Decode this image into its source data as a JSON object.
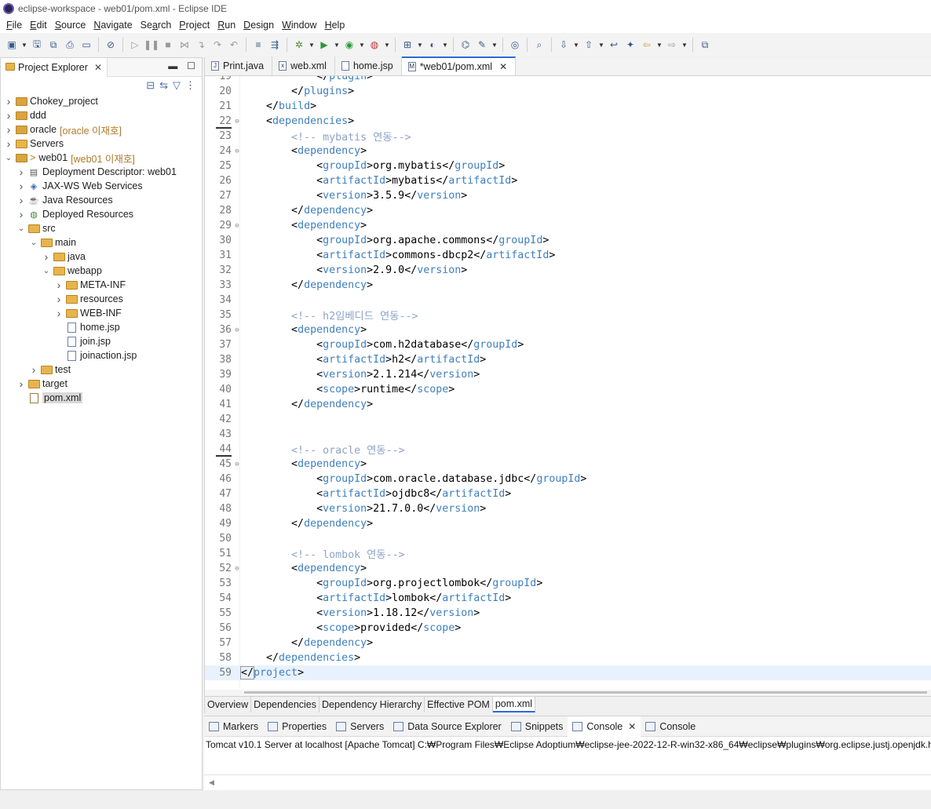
{
  "window": {
    "title": "eclipse-workspace - web01/pom.xml - Eclipse IDE"
  },
  "menu": [
    {
      "label": "File",
      "mn": "F",
      "rest": "ile"
    },
    {
      "label": "Edit",
      "mn": "E",
      "rest": "dit"
    },
    {
      "label": "Source",
      "mn": "S",
      "rest": "ource"
    },
    {
      "label": "Navigate",
      "mn": "N",
      "rest": "avigate"
    },
    {
      "label": "Search",
      "mn": "a",
      "pre": "Se",
      "rest": "rch"
    },
    {
      "label": "Project",
      "mn": "P",
      "rest": "roject"
    },
    {
      "label": "Run",
      "mn": "R",
      "rest": "un"
    },
    {
      "label": "Design",
      "mn": "D",
      "rest": "esign"
    },
    {
      "label": "Window",
      "mn": "W",
      "rest": "indow"
    },
    {
      "label": "Help",
      "mn": "H",
      "rest": "elp"
    }
  ],
  "explorer": {
    "tab_label": "Project Explorer",
    "items": [
      {
        "label": "Chokey_project",
        "decoration": ""
      },
      {
        "label": "ddd",
        "decoration": ""
      },
      {
        "label": "oracle",
        "decoration": "[oracle 이재호]"
      },
      {
        "label": "Servers",
        "decoration": ""
      },
      {
        "label": "web01",
        "prefix": ">",
        "decoration": "[web01 이재호]"
      },
      {
        "label": "Deployment Descriptor: web01",
        "decoration": ""
      },
      {
        "label": "JAX-WS Web Services",
        "decoration": ""
      },
      {
        "label": "Java Resources",
        "decoration": ""
      },
      {
        "label": "Deployed Resources",
        "decoration": ""
      },
      {
        "label": "src",
        "decoration": ""
      },
      {
        "label": "main",
        "decoration": ""
      },
      {
        "label": "java",
        "decoration": ""
      },
      {
        "label": "webapp",
        "decoration": ""
      },
      {
        "label": "META-INF",
        "decoration": ""
      },
      {
        "label": "resources",
        "decoration": ""
      },
      {
        "label": "WEB-INF",
        "decoration": ""
      },
      {
        "label": "home.jsp",
        "decoration": ""
      },
      {
        "label": "join.jsp",
        "decoration": ""
      },
      {
        "label": "joinaction.jsp",
        "decoration": ""
      },
      {
        "label": "test",
        "decoration": ""
      },
      {
        "label": "target",
        "decoration": ""
      },
      {
        "label": "pom.xml",
        "decoration": ""
      }
    ]
  },
  "editor": {
    "tabs": [
      {
        "label": "Print.java",
        "icon": "java-file-icon"
      },
      {
        "label": "web.xml",
        "icon": "xml-file-icon"
      },
      {
        "label": "home.jsp",
        "icon": "jsp-file-icon"
      },
      {
        "label": "*web01/pom.xml",
        "icon": "maven-pom-icon",
        "active": true
      }
    ],
    "lines": [
      {
        "n": "19",
        "text": "            </plugin>"
      },
      {
        "n": "20",
        "text": "        </plugins>"
      },
      {
        "n": "21",
        "text": "    </build>"
      },
      {
        "n": "22",
        "text": "    <dependencies>",
        "fold": true
      },
      {
        "n": "23",
        "text": "        <!-- mybatis 연동-->"
      },
      {
        "n": "24",
        "text": "        <dependency>",
        "fold": true
      },
      {
        "n": "25",
        "text": "            <groupId>org.mybatis</groupId>"
      },
      {
        "n": "26",
        "text": "            <artifactId>mybatis</artifactId>"
      },
      {
        "n": "27",
        "text": "            <version>3.5.9</version>"
      },
      {
        "n": "28",
        "text": "        </dependency>"
      },
      {
        "n": "29",
        "text": "        <dependency>",
        "fold": true
      },
      {
        "n": "30",
        "text": "            <groupId>org.apache.commons</groupId>"
      },
      {
        "n": "31",
        "text": "            <artifactId>commons-dbcp2</artifactId>"
      },
      {
        "n": "32",
        "text": "            <version>2.9.0</version>"
      },
      {
        "n": "33",
        "text": "        </dependency>"
      },
      {
        "n": "34",
        "text": ""
      },
      {
        "n": "35",
        "text": "        <!-- h2임베디드 연동-->"
      },
      {
        "n": "36",
        "text": "        <dependency>",
        "fold": true
      },
      {
        "n": "37",
        "text": "            <groupId>com.h2database</groupId>"
      },
      {
        "n": "38",
        "text": "            <artifactId>h2</artifactId>"
      },
      {
        "n": "39",
        "text": "            <version>2.1.214</version>"
      },
      {
        "n": "40",
        "text": "            <scope>runtime</scope>"
      },
      {
        "n": "41",
        "text": "        </dependency>"
      },
      {
        "n": "42",
        "text": ""
      },
      {
        "n": "43",
        "text": ""
      },
      {
        "n": "44",
        "text": "        <!-- oracle 연동-->"
      },
      {
        "n": "45",
        "text": "        <dependency>",
        "fold": true
      },
      {
        "n": "46",
        "text": "            <groupId>com.oracle.database.jdbc</groupId>"
      },
      {
        "n": "47",
        "text": "            <artifactId>ojdbc8</artifactId>"
      },
      {
        "n": "48",
        "text": "            <version>21.7.0.0</version>"
      },
      {
        "n": "49",
        "text": "        </dependency>"
      },
      {
        "n": "50",
        "text": ""
      },
      {
        "n": "51",
        "text": "        <!-- lombok 연동-->"
      },
      {
        "n": "52",
        "text": "        <dependency>",
        "fold": true
      },
      {
        "n": "53",
        "text": "            <groupId>org.projectlombok</groupId>"
      },
      {
        "n": "54",
        "text": "            <artifactId>lombok</artifactId>"
      },
      {
        "n": "55",
        "text": "            <version>1.18.12</version>"
      },
      {
        "n": "56",
        "text": "            <scope>provided</scope>"
      },
      {
        "n": "57",
        "text": "        </dependency>"
      },
      {
        "n": "58",
        "text": "    </dependencies>"
      },
      {
        "n": "59",
        "text": "</project>",
        "current": true
      }
    ],
    "bottom_tabs": [
      "Overview",
      "Dependencies",
      "Dependency Hierarchy",
      "Effective POM",
      "pom.xml"
    ],
    "active_bottom_tab": "pom.xml"
  },
  "console": {
    "tabs": [
      {
        "label": "Markers"
      },
      {
        "label": "Properties"
      },
      {
        "label": "Servers"
      },
      {
        "label": "Data Source Explorer"
      },
      {
        "label": "Snippets"
      },
      {
        "label": "Console",
        "active": true,
        "closable": true
      },
      {
        "label": "Console"
      }
    ],
    "output": "Tomcat v10.1 Server at localhost [Apache Tomcat] C:₩Program Files₩Eclipse Adoptium₩eclipse-jee-2022-12-R-win32-x86_64₩eclipse₩plugins₩org.eclipse.justj.openjdk.h"
  },
  "colors": {
    "tag": "#3f7fbf",
    "comment": "#8ea3c7",
    "current_line": "#e8f2fe",
    "active_tab_accent": "#2b6bd6"
  }
}
